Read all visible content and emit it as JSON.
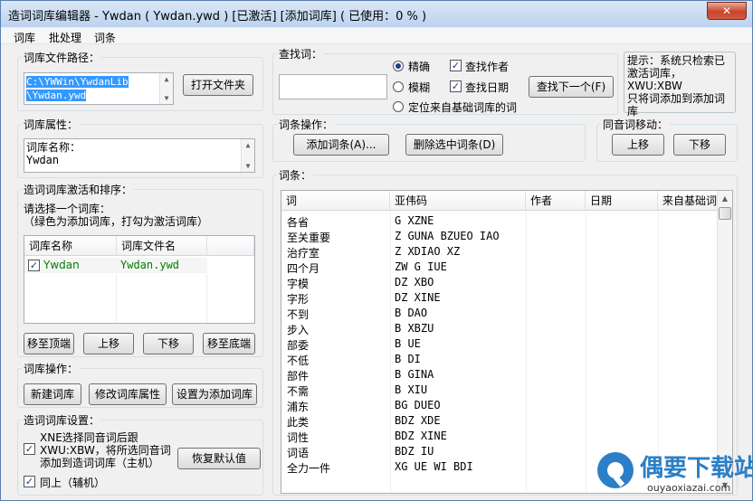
{
  "window": {
    "title": "造词词库编辑器 - Ywdan ( Ywdan.ywd ) [已激活] [添加词库] ( 已使用：0 % )",
    "close_label": "✕"
  },
  "menu": [
    "词库",
    "批处理",
    "词条"
  ],
  "lib_path": {
    "title": "词库文件路径：",
    "value_line1": "C:\\YWWin\\YwdanLib",
    "value_line2": "\\Ywdan.ywd",
    "open_folder_button": "打开文件夹"
  },
  "lib_props": {
    "title": "词库属性：",
    "line1": "词库名称：",
    "line2": "Ywdan"
  },
  "activate": {
    "title": "造词词库激活和排序：",
    "hint1": "请选择一个词库：",
    "hint2": "（绿色为添加词库，打勾为激活词库）",
    "col_name": "词库名称",
    "col_file": "词库文件名",
    "rows": [
      {
        "name": "Ywdan",
        "file": "Ywdan.ywd",
        "checked": "✓"
      }
    ],
    "buttons": [
      "移至顶端",
      "上移",
      "下移",
      "移至底端"
    ],
    "added_color": "#008000"
  },
  "lib_ops": {
    "title": "词库操作：",
    "buttons": [
      "新建词库",
      "修改词库属性",
      "设置为添加词库"
    ]
  },
  "settings": {
    "title": "造词词库设置：",
    "opt1_line1": "XNE选择同音词后跟",
    "opt1_line2": "XWU:XBW，将所选同音词",
    "opt1_line3": "添加到造词词库（主机）",
    "opt1_checked": "✓",
    "opt2": "同上（辅机）",
    "opt2_checked": "✓",
    "restore_button": "恢复默认值"
  },
  "search": {
    "title": "查找词：",
    "value": "",
    "exact": "精确",
    "fuzzy": "模糊",
    "find_author": "查找作者",
    "find_author_checked": "✓",
    "find_date": "查找日期",
    "find_date_checked": "✓",
    "locate": "定位来自基础词库的词",
    "find_next_button": "查找下一个(F)"
  },
  "tip": {
    "line1": "提示：系统只检索已",
    "line2": "激活词库，XWU:XBW",
    "line3": "只将词添加到添加词",
    "line4": "库"
  },
  "entry_ops": {
    "title": "词条操作：",
    "add_button": "添加词条(A)...",
    "delete_button": "删除选中词条(D)"
  },
  "homophone": {
    "title": "同音词移动：",
    "up_button": "上移",
    "down_button": "下移"
  },
  "entries": {
    "title": "词条：",
    "columns": [
      "词",
      "亚伟码",
      "作者",
      "日期",
      "来自基础词"
    ],
    "rows": [
      [
        "各省",
        "G XZNE"
      ],
      [
        "至关重要",
        "Z GUNA BZUEO IAO"
      ],
      [
        "治疗室",
        "Z XDIAO XZ"
      ],
      [
        "四个月",
        "ZW G IUE"
      ],
      [
        "字模",
        "DZ XBO"
      ],
      [
        "字形",
        "DZ XINE"
      ],
      [
        "不到",
        "B DAO"
      ],
      [
        "步入",
        "B XBZU"
      ],
      [
        "部委",
        "B UE"
      ],
      [
        "不低",
        "B DI"
      ],
      [
        "部件",
        "B GINA"
      ],
      [
        "不需",
        "B XIU"
      ],
      [
        "浦东",
        "BG DUEO"
      ],
      [
        "此类",
        "BDZ XDE"
      ],
      [
        "词性",
        "BDZ XINE"
      ],
      [
        "词语",
        "BDZ IU"
      ],
      [
        "全力一件",
        "XG UE WI BDI"
      ]
    ]
  },
  "watermark": {
    "brand": "偶要下载站",
    "url": "ouyaoxiazai.com",
    "brand_color": "#2b7fc6"
  }
}
